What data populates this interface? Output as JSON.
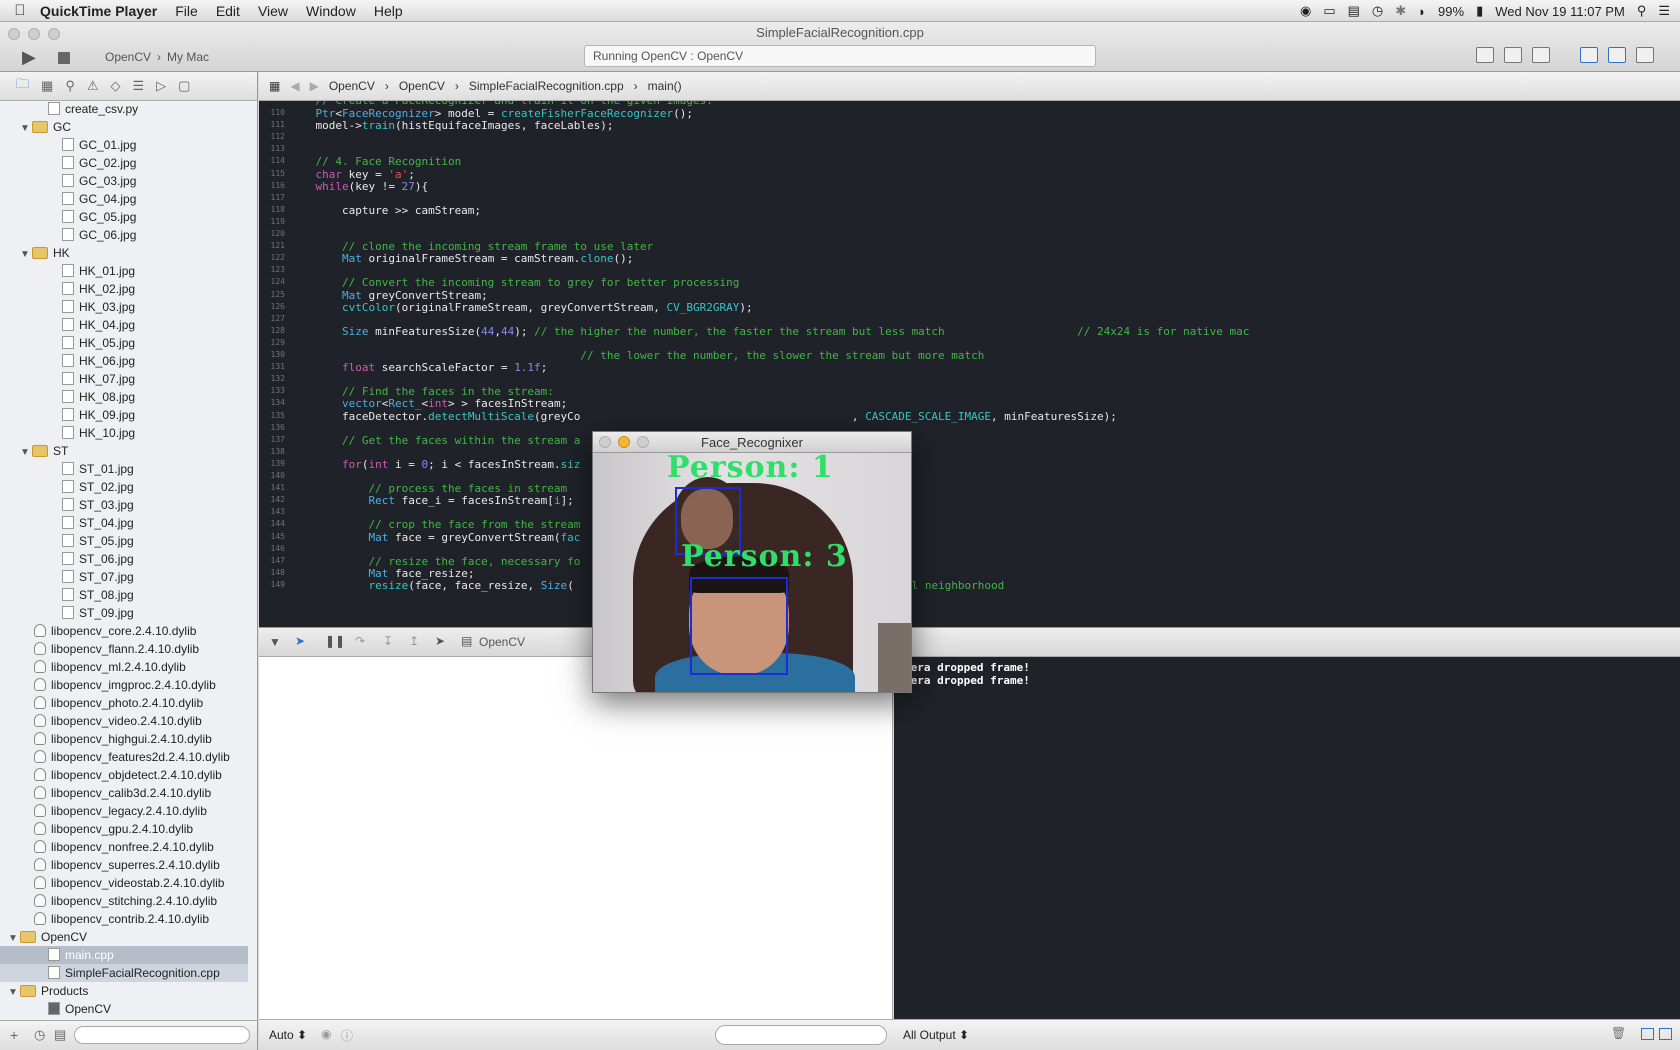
{
  "menubar": {
    "app": "QuickTime Player",
    "items": [
      "File",
      "Edit",
      "View",
      "Window",
      "Help"
    ],
    "battery": "99%",
    "clock": "Wed Nov 19  11:07 PM"
  },
  "window": {
    "title": "SimpleFacialRecognition.cpp",
    "scheme_project": "OpenCV",
    "scheme_target": "My Mac",
    "activity": "Running OpenCV : OpenCV"
  },
  "jumpbar": [
    "OpenCV",
    "OpenCV",
    "SimpleFacialRecognition.cpp",
    "main()"
  ],
  "tree": [
    {
      "t": "f",
      "name": "create_csv.py",
      "d": 2
    },
    {
      "t": "d",
      "name": "GC",
      "d": 1
    },
    {
      "t": "f",
      "name": "GC_01.jpg",
      "d": 3
    },
    {
      "t": "f",
      "name": "GC_02.jpg",
      "d": 3
    },
    {
      "t": "f",
      "name": "GC_03.jpg",
      "d": 3
    },
    {
      "t": "f",
      "name": "GC_04.jpg",
      "d": 3
    },
    {
      "t": "f",
      "name": "GC_05.jpg",
      "d": 3
    },
    {
      "t": "f",
      "name": "GC_06.jpg",
      "d": 3
    },
    {
      "t": "d",
      "name": "HK",
      "d": 1
    },
    {
      "t": "f",
      "name": "HK_01.jpg",
      "d": 3
    },
    {
      "t": "f",
      "name": "HK_02.jpg",
      "d": 3
    },
    {
      "t": "f",
      "name": "HK_03.jpg",
      "d": 3
    },
    {
      "t": "f",
      "name": "HK_04.jpg",
      "d": 3
    },
    {
      "t": "f",
      "name": "HK_05.jpg",
      "d": 3
    },
    {
      "t": "f",
      "name": "HK_06.jpg",
      "d": 3
    },
    {
      "t": "f",
      "name": "HK_07.jpg",
      "d": 3
    },
    {
      "t": "f",
      "name": "HK_08.jpg",
      "d": 3
    },
    {
      "t": "f",
      "name": "HK_09.jpg",
      "d": 3
    },
    {
      "t": "f",
      "name": "HK_10.jpg",
      "d": 3
    },
    {
      "t": "d",
      "name": "ST",
      "d": 1
    },
    {
      "t": "f",
      "name": "ST_01.jpg",
      "d": 3
    },
    {
      "t": "f",
      "name": "ST_02.jpg",
      "d": 3
    },
    {
      "t": "f",
      "name": "ST_03.jpg",
      "d": 3
    },
    {
      "t": "f",
      "name": "ST_04.jpg",
      "d": 3
    },
    {
      "t": "f",
      "name": "ST_05.jpg",
      "d": 3
    },
    {
      "t": "f",
      "name": "ST_06.jpg",
      "d": 3
    },
    {
      "t": "f",
      "name": "ST_07.jpg",
      "d": 3
    },
    {
      "t": "f",
      "name": "ST_08.jpg",
      "d": 3
    },
    {
      "t": "f",
      "name": "ST_09.jpg",
      "d": 3
    },
    {
      "t": "l",
      "name": "libopencv_core.2.4.10.dylib",
      "d": 1
    },
    {
      "t": "l",
      "name": "libopencv_flann.2.4.10.dylib",
      "d": 1
    },
    {
      "t": "l",
      "name": "libopencv_ml.2.4.10.dylib",
      "d": 1
    },
    {
      "t": "l",
      "name": "libopencv_imgproc.2.4.10.dylib",
      "d": 1
    },
    {
      "t": "l",
      "name": "libopencv_photo.2.4.10.dylib",
      "d": 1
    },
    {
      "t": "l",
      "name": "libopencv_video.2.4.10.dylib",
      "d": 1
    },
    {
      "t": "l",
      "name": "libopencv_highgui.2.4.10.dylib",
      "d": 1
    },
    {
      "t": "l",
      "name": "libopencv_features2d.2.4.10.dylib",
      "d": 1
    },
    {
      "t": "l",
      "name": "libopencv_objdetect.2.4.10.dylib",
      "d": 1
    },
    {
      "t": "l",
      "name": "libopencv_calib3d.2.4.10.dylib",
      "d": 1
    },
    {
      "t": "l",
      "name": "libopencv_legacy.2.4.10.dylib",
      "d": 1
    },
    {
      "t": "l",
      "name": "libopencv_gpu.2.4.10.dylib",
      "d": 1
    },
    {
      "t": "l",
      "name": "libopencv_nonfree.2.4.10.dylib",
      "d": 1
    },
    {
      "t": "l",
      "name": "libopencv_superres.2.4.10.dylib",
      "d": 1
    },
    {
      "t": "l",
      "name": "libopencv_videostab.2.4.10.dylib",
      "d": 1
    },
    {
      "t": "l",
      "name": "libopencv_stitching.2.4.10.dylib",
      "d": 1
    },
    {
      "t": "l",
      "name": "libopencv_contrib.2.4.10.dylib",
      "d": 1
    },
    {
      "t": "d",
      "name": "OpenCV",
      "d": 0
    },
    {
      "t": "f",
      "name": "main.cpp",
      "d": 2,
      "sel": "sel2"
    },
    {
      "t": "f",
      "name": "SimpleFacialRecognition.cpp",
      "d": 2,
      "sel": "sel"
    },
    {
      "t": "d",
      "name": "Products",
      "d": 0
    },
    {
      "t": "p",
      "name": "OpenCV",
      "d": 2
    }
  ],
  "code": [
    {
      "n": "110",
      "h": "    <span class='ty'>Ptr</span>&lt;<span class='ty'>FaceRecognizer</span>&gt; model = <span class='fn'>createFisherFaceRecognizer</span>();"
    },
    {
      "n": "111",
      "h": "    model-&gt;<span class='fn'>train</span>(histEquifaceImages, faceLables);"
    },
    {
      "n": "112",
      "h": ""
    },
    {
      "n": "113",
      "h": ""
    },
    {
      "n": "114",
      "h": "    <span class='cm'>// 4. Face Recognition</span>"
    },
    {
      "n": "115",
      "h": "    <span class='kw'>char</span> key = <span class='st'>'a'</span>;"
    },
    {
      "n": "116",
      "h": "    <span class='kw'>while</span>(key != <span class='nm'>27</span>){"
    },
    {
      "n": "117",
      "h": ""
    },
    {
      "n": "118",
      "h": "        capture &gt;&gt; camStream;"
    },
    {
      "n": "119",
      "h": ""
    },
    {
      "n": "120",
      "h": ""
    },
    {
      "n": "121",
      "h": "        <span class='cm'>// clone the incoming stream frame to use later</span>"
    },
    {
      "n": "122",
      "h": "        <span class='ty'>Mat</span> originalFrameStream = camStream.<span class='fn'>clone</span>();"
    },
    {
      "n": "123",
      "h": ""
    },
    {
      "n": "124",
      "h": "        <span class='cm'>// Convert the incoming stream to grey for better processing</span>"
    },
    {
      "n": "125",
      "h": "        <span class='ty'>Mat</span> greyConvertStream;"
    },
    {
      "n": "126",
      "h": "        <span class='fn'>cvtColor</span>(originalFrameStream, greyConvertStream, <span class='fn'>CV_BGR2GRAY</span>);"
    },
    {
      "n": "127",
      "h": ""
    },
    {
      "n": "128",
      "h": "        <span class='ty'>Size</span> minFeaturesSize(<span class='nm'>44</span>,<span class='nm'>44</span>); <span class='cm'>// the higher the number, the faster the stream but less match                    // 24x24 is for native mac</span>"
    },
    {
      "n": "129",
      "h": ""
    },
    {
      "n": "130",
      "h": "                                            <span class='cm'>// the lower the number, the slower the stream but more match</span>"
    },
    {
      "n": "131",
      "h": "        <span class='kw'>float</span> searchScaleFactor = <span class='nm'>1.1f</span>;"
    },
    {
      "n": "132",
      "h": ""
    },
    {
      "n": "133",
      "h": "        <span class='cm'>// Find the faces in the stream:</span>"
    },
    {
      "n": "134",
      "h": "        <span class='ty'>vector</span>&lt;<span class='ty'>Rect_</span>&lt;<span class='kw'>int</span>&gt; &gt; facesInStream;"
    },
    {
      "n": "135",
      "h": "        faceDetector.<span class='fn'>detectMultiScale</span>(greyCo                                         , <span class='fn'>CASCADE_SCALE_IMAGE</span>, minFeaturesSize);"
    },
    {
      "n": "136",
      "h": ""
    },
    {
      "n": "137",
      "h": "        <span class='cm'>// Get the faces within the stream a</span>"
    },
    {
      "n": "138",
      "h": ""
    },
    {
      "n": "139",
      "h": "        <span class='kw'>for</span>(<span class='kw'>int</span> i = <span class='nm'>0</span>; i &lt; facesInStream.<span class='fn'>siz</span>"
    },
    {
      "n": "140",
      "h": ""
    },
    {
      "n": "141",
      "h": "            <span class='cm'>// process the faces in stream</span>"
    },
    {
      "n": "142",
      "h": "            <span class='ty'>Rect</span> face_i = facesInStream[<span class='nm'>i</span>];"
    },
    {
      "n": "143",
      "h": ""
    },
    {
      "n": "144",
      "h": "            <span class='cm'>// crop the face from the stream</span>"
    },
    {
      "n": "145",
      "h": "            <span class='ty'>Mat</span> face = greyConvertStream(<span class='fn'>fac</span>"
    },
    {
      "n": "146",
      "h": ""
    },
    {
      "n": "147",
      "h": "            <span class='cm'>// resize the face, necessary fo</span>"
    },
    {
      "n": "148",
      "h": "            <span class='ty'>Mat</span> face_resize;"
    },
    {
      "n": "149",
      "h": "            <span class='fn'>resize</span>(face, face_resize, <span class='ty'>Size</span>(                                           <span class='cm'>8x8 pixel neighborhood</span>"
    }
  ],
  "debug": {
    "target": "OpenCV"
  },
  "console": {
    "lines": [
      "mera dropped frame!",
      "mera dropped frame!"
    ]
  },
  "bottom": {
    "auto_label": "Auto ⬍",
    "output_label": "All Output ⬍"
  },
  "facewin": {
    "title": "Face_Recognixer",
    "label1": "Person: 1",
    "label2": "Person: 3"
  }
}
